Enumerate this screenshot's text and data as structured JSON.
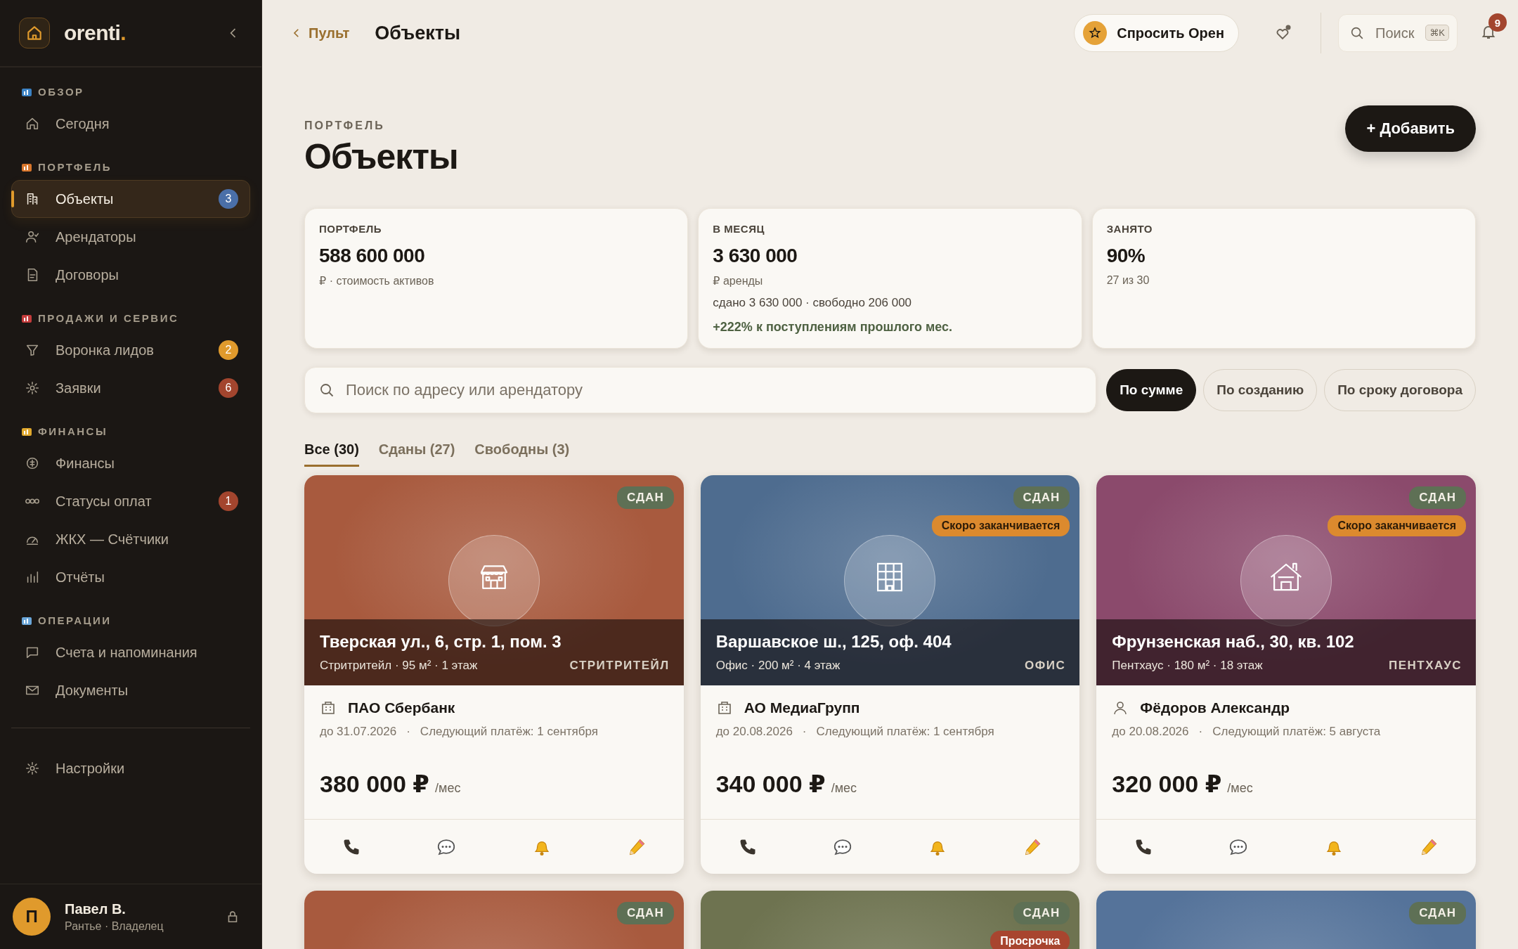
{
  "sidebar": {
    "logo": "orenti",
    "logo_dot": ".",
    "sections": [
      {
        "title": "ОБЗОР",
        "items": [
          {
            "label": "Сегодня",
            "selected": false
          }
        ]
      },
      {
        "title": "ПОРТФЕЛЬ",
        "items": [
          {
            "label": "Объекты",
            "selected": true,
            "badge": "3",
            "color": "#4a6fa8"
          },
          {
            "label": "Арендаторы",
            "selected": false
          },
          {
            "label": "Договоры",
            "selected": false
          }
        ]
      },
      {
        "title": "ПРОДАЖИ И СЕРВИС",
        "items": [
          {
            "label": "Воронка лидов",
            "selected": false,
            "badge": "2",
            "color": "#e09a2c"
          },
          {
            "label": "Заявки",
            "selected": false,
            "badge": "6",
            "color": "#a3452e"
          }
        ]
      },
      {
        "title": "ФИНАНСЫ",
        "items": [
          {
            "label": "Финансы",
            "selected": false
          },
          {
            "label": "Статусы оплат",
            "selected": false,
            "badge": "1",
            "color": "#a3452e"
          },
          {
            "label": "ЖКХ — Счётчики",
            "selected": false
          },
          {
            "label": "Отчёты",
            "selected": false
          }
        ]
      },
      {
        "title": "ОПЕРАЦИИ",
        "items": [
          {
            "label": "Счета и напоминания",
            "selected": false
          },
          {
            "label": "Документы",
            "selected": false
          }
        ]
      }
    ],
    "settings": {
      "label": "Настройки",
      "selected": false
    },
    "user": {
      "initial": "П",
      "name": "Павел В.",
      "role": "Рантье · Владелец"
    }
  },
  "topbar": {
    "back": "Пульт",
    "title": "Объекты",
    "ask": "Спросить Орен",
    "search_placeholder": "Поиск",
    "shortcut": "⌘K",
    "notifications": "9"
  },
  "header": {
    "eyebrow": "ПОРТФЕЛЬ",
    "title": "Объекты",
    "add": "+ Добавить"
  },
  "stats": [
    {
      "label": "ПОРТФЕЛЬ",
      "value": "588 600 000",
      "sub": "₽ · стоимость активов"
    },
    {
      "label": "В МЕСЯЦ",
      "value": "3 630 000",
      "sub": "₽ аренды",
      "detail": "сдано 3 630 000 · свободно 206 000",
      "trend": "+222% к поступлениям прошлого мес."
    },
    {
      "label": "ЗАНЯТО",
      "value": "90%",
      "sub": "27 из 30"
    }
  ],
  "search": {
    "placeholder": "Поиск по адресу или арендатору"
  },
  "sort": [
    {
      "label": "По сумме",
      "selected": true
    },
    {
      "label": "По созданию",
      "selected": false
    },
    {
      "label": "По сроку договора",
      "selected": false
    }
  ],
  "tabs": [
    {
      "label": "Все (30)",
      "selected": true
    },
    {
      "label": "Сданы (27)",
      "selected": false
    },
    {
      "label": "Свободны (3)",
      "selected": false
    }
  ],
  "cards": [
    {
      "color": "#a85a3e",
      "tags": [
        {
          "label": "СДАН",
          "kind": "status"
        }
      ],
      "title": "Тверская ул., 6, стр. 1, пом. 3",
      "details": "Стритритейл · 95 м² · 1 этаж",
      "category": "СТРИТРИТЕЙЛ",
      "tenant": "ПАО Сбербанк",
      "kind": "company",
      "until": "до 31.07.2026",
      "separator": "·",
      "next_payment": "Следующий платёж: 1 сентября",
      "price": "380 000 ₽",
      "unit": "/мес"
    },
    {
      "color": "#4e6c8f",
      "tags": [
        {
          "label": "СДАН",
          "kind": "status"
        },
        {
          "label": "Скоро заканчивается",
          "kind": "warning"
        }
      ],
      "title": "Варшавское ш., 125, оф. 404",
      "details": "Офис · 200 м² · 4 этаж",
      "category": "ОФИС",
      "tenant": "АО МедиаГрупп",
      "kind": "company",
      "until": "до 20.08.2026",
      "separator": "·",
      "next_payment": "Следующий платёж: 1 сентября",
      "price": "340 000 ₽",
      "unit": "/мес"
    },
    {
      "color": "#8b4a6c",
      "tags": [
        {
          "label": "СДАН",
          "kind": "status"
        },
        {
          "label": "Скоро заканчивается",
          "kind": "warning"
        }
      ],
      "title": "Фрунзенская наб., 30, кв. 102",
      "details": "Пентхаус · 180 м² · 18 этаж",
      "category": "ПЕНТХАУС",
      "tenant": "Фёдоров Александр",
      "kind": "person",
      "until": "до 20.08.2026",
      "separator": "·",
      "next_payment": "Следующий платёж: 5 августа",
      "price": "320 000 ₽",
      "unit": "/мес"
    },
    {
      "color": "#a85a3e",
      "tags": [
        {
          "label": "СДАН",
          "kind": "status"
        }
      ]
    },
    {
      "color": "#6e7350",
      "tags": [
        {
          "label": "СДАН",
          "kind": "status"
        },
        {
          "label": "Просрочка",
          "kind": "overdue"
        }
      ]
    },
    {
      "color": "#55739a",
      "tags": [
        {
          "label": "СДАН",
          "kind": "status"
        }
      ]
    }
  ]
}
